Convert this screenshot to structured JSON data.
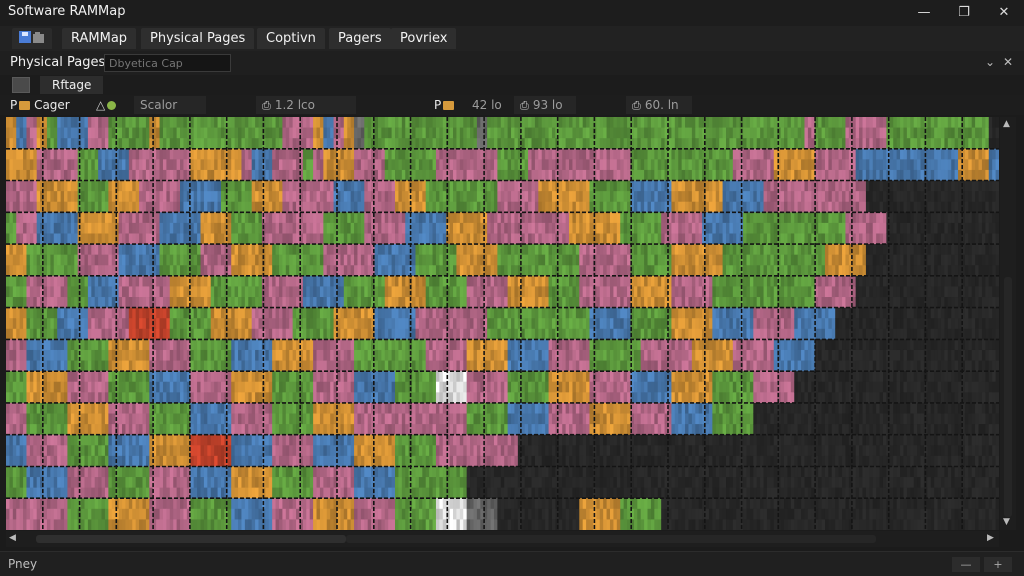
{
  "app": {
    "title": "Software RAMMap",
    "window_controls": {
      "minimize": "—",
      "maximize": "❐",
      "close": "✕"
    }
  },
  "tabs": [
    {
      "label": "RAMMap"
    },
    {
      "label": "Physical  Pages"
    },
    {
      "label": "Coptivn"
    },
    {
      "label": "Pagers"
    },
    {
      "label": "Povriex"
    }
  ],
  "panel": {
    "title": "Physical Pages",
    "search_placeholder": "Dbyetica Cap",
    "controls": {
      "pin": "⌄",
      "close": "✕"
    }
  },
  "filter": {
    "label": "Rftage"
  },
  "toolbar": {
    "item1_prefix": "P",
    "item1_label": "Cager",
    "field1": "Scalor",
    "field2": "1.2 lco",
    "item3_prefix": "P",
    "field3": "42 lo",
    "field4": "93 lo",
    "field5": "60. ln"
  },
  "status": {
    "text": "Pney",
    "zoom_out": "—",
    "zoom_in": "+"
  },
  "colors": {
    "green": "#5f9d3f",
    "blue": "#4a7cb3",
    "pink": "#b86a8a",
    "orange": "#d69436",
    "gray": "#6a6a6a",
    "red": "#c8442c",
    "dark": "#262626",
    "empty": "#1f1f1f",
    "white": "#e8e8e8"
  },
  "map": {
    "block_rows": [
      "OBPOGBBBPPGGGGOGGGGGGGGGGGGPPPOBPOSGGGGGGGGGGGSGGGGGGGGGGGGGGGGGGGGGGGGGGGGGGGPGGGPPPPGGGGGGGGGG",
      "OOOPPPPGGBBBPPPPPPOOOOOPBBPPPGPOOOPPPGGGGGPPPPPPGGGPPPPPPPPPPGGGGGGGGGGPPPPOOOOPPPPBBBBBBBBBBOOOB",
      "PPPOOOOGGGOOOPPPPBBBBGGGOOOPPPPPBBBPPPOOOGGGGGGGPPPPOOOOOGGGGBBBBOOOOOBBBBPPPPPPPPPPDDDDDDDDDDDDD",
      "GPPBBBBOOOOPPPPBBBBOOOGGGPPPPPPGGGGPPPPBBBBOOOOPPPPPPPPOOOOOGGGGPPPPBBBBGGGGGGGGGGPPPPDDDDDDDDDDD",
      "OOGGGGGPPPPBBBBGGGGPPPOOOOGGGGGPPPPPBBBBGGGGOOOOGGGGGGGGPPPPPGGGGOOOOOGGGGGGGGGGOOOODDDDDDDDDDDD",
      "GGPPPPGGBBBPPPPPOOOOGGGGGPPPPBBBBGGGGOOOOGGGGPPPPOOOOGGGPPPPPOOOOPPPPGGGGGGGGGGPPPPDDDDDDDDDDDDDD",
      "OOGGGBBBPPPPRRRRGGGGOOOOPPPPGGGGOOOOBBBBPPPPPPPGGGGGGGGGGBBBBGGGGOOOOBBBBPPPPBBBBDDDDDDDDDDDDDDD",
      "PPBBBBGGGGOOOOPPPPGGGGBBBBOOOOPPPPGGGGGGGPPPPOOOOBBBBPPPPGGGGGPPPPPOOOOPPPPBBBBDDDDDDDDDDDDDDDDD",
      "GGOOOOPPPPGGGGBBBBPPPPOOOOGGGGPPPPBBBBGGGGWWWPPPPGGGGOOOOPPPPBBBBOOOOGGGGPPPPDDDDDDDDDDDDDDDDDDD",
      "PPGGGGOOOOPPPPGGGGBBBBPPPPGGGGOOOOPPPPPPPPPPPGGGGBBBBPPPPOOOOPPPPBBBBGGGGDDDDDDDDDDDDDDDDDDDDDDD",
      "BBPPPPGGGGBBBBOOOORRRRBBBBPPPPBBBBOOOOGGGGPPPPPPPPDDDDDDDDDDDDDDDDDDDDDDDDDDDDDDDDDDDDDDDDDDDDDDD",
      "GGBBBBPPPPGGGGPPPPBBBBOOOOGGGGPPPPBBBBGGGGGGGDDDDDDDDDDDDDDDDDDDDDDDDDDDDDDDDDDDDDDDDDDDDDDDDDD",
      "PPPPPPGGGGOOOOPPPPGGGGBBBBPPPPOOOOPPPPGGGGWWWSSSDDDDDDDDOOOOGGGGDDDDDDDDDDDDDDDDDDDDDDDDDDDDDDD"
    ]
  }
}
